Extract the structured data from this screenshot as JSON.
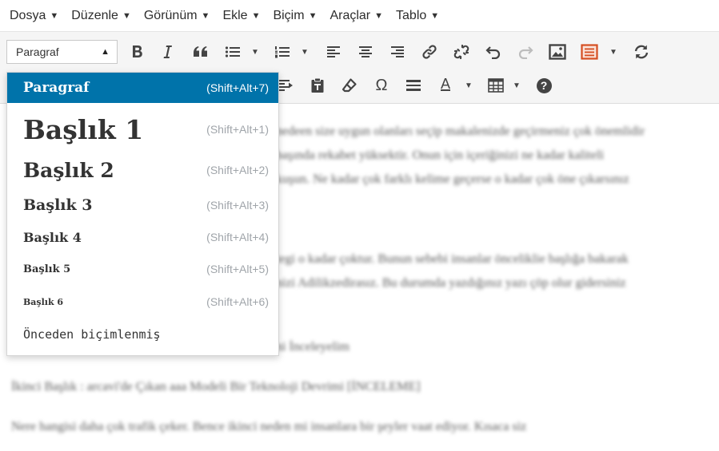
{
  "menubar": {
    "items": [
      "Dosya",
      "Düzenle",
      "Görünüm",
      "Ekle",
      "Biçim",
      "Araçlar",
      "Tablo"
    ]
  },
  "toolbar": {
    "format_select_value": "Paragraf",
    "row1_icons": [
      "bold-icon",
      "italic-icon",
      "blockquote-icon",
      "bullet-list-icon",
      "numbered-list-icon",
      "align-left-icon",
      "align-center-icon",
      "align-right-icon",
      "link-icon",
      "unlink-icon",
      "undo-icon",
      "redo-icon",
      "image-icon",
      "media-icon",
      "refresh-icon"
    ],
    "row2_icons": [
      "indent-icon",
      "paste-text-icon",
      "clear-format-icon",
      "omega-icon",
      "horizontal-rule-icon",
      "text-color-icon",
      "table-icon",
      "help-icon"
    ],
    "omega_glyph": "Ω",
    "text_color_glyph": "A",
    "help_glyph": "?",
    "accent_color": "#0073aa",
    "media_color": "#d54e21"
  },
  "dropdown": {
    "items": [
      {
        "label": "Paragraf",
        "shortcut": "(Shift+Alt+7)"
      },
      {
        "label": "Başlık 1",
        "shortcut": "(Shift+Alt+1)"
      },
      {
        "label": "Başlık 2",
        "shortcut": "(Shift+Alt+2)"
      },
      {
        "label": "Başlık 3",
        "shortcut": "(Shift+Alt+3)"
      },
      {
        "label": "Başlık 4",
        "shortcut": "(Shift+Alt+4)"
      },
      {
        "label": "Başlık 5",
        "shortcut": "(Shift+Alt+5)"
      },
      {
        "label": "Başlık 6",
        "shortcut": "(Shift+Alt+6)"
      },
      {
        "label": "Önceden biçimlenmiş",
        "shortcut": ""
      }
    ]
  },
  "content": {
    "lines": [
      "nedeen size uygun olanları seçip makalenizde geçirmeniz çok önemlidir",
      "başında rekabet yüksektir. Onun için içeriğinizi ne kadar kaliteli",
      "kuşun. Ne kadar çok farklı kelime geçerse o kadar çok öne çıkarsınız",
      "tegi o kadar çoktur. Bunun sebebi insanlar önceliklie başlığa bakarak",
      "nizi Adilikzedirasız. Bu durumda yazdığınız yazı çöp olur gidersiniz",
      "ni İnceleyelim",
      "İkinci Başlık : arcavi'de Çıkan aaa Modeli Bir Teknoloji Devrimi [İNCELEME]",
      "Nere hangisi daha çok trafik çeker. Bence ikinci neden mi insanlara bir şeyler vaat ediyor. Kısaca siz"
    ]
  }
}
